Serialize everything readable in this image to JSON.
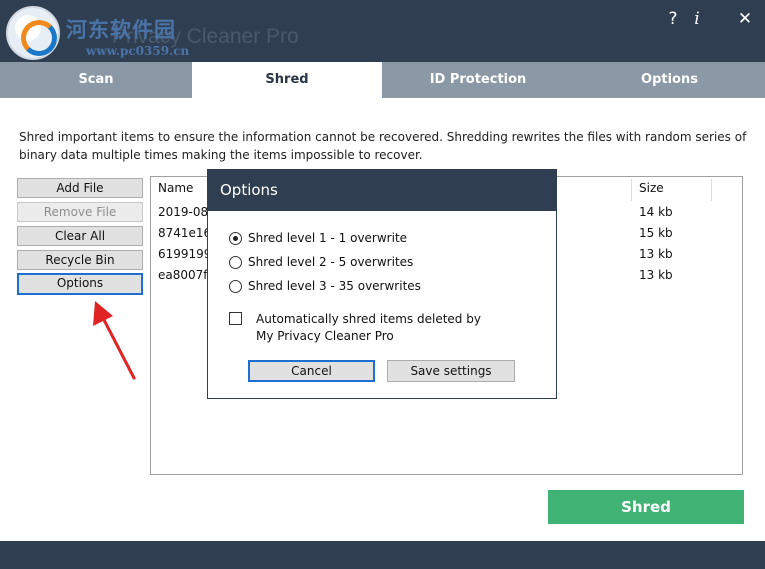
{
  "window": {
    "title": "Privacy Cleaner Pro",
    "watermark": "河东软件园",
    "watermark_url": "www.pc0359.cn",
    "help_label": "?",
    "info_label": "i",
    "close_label": "✕"
  },
  "tabs": [
    {
      "label": "Scan",
      "active": false
    },
    {
      "label": "Shred",
      "active": true
    },
    {
      "label": "ID Protection",
      "active": false
    },
    {
      "label": "Options",
      "active": false
    }
  ],
  "description": "Shred important items to ensure the information cannot be recovered. Shredding rewrites the files with random series of binary data multiple times making the items impossible to recover.",
  "side_buttons": [
    {
      "label": "Add File",
      "enabled": true
    },
    {
      "label": "Remove File",
      "enabled": false
    },
    {
      "label": "Clear All",
      "enabled": true
    },
    {
      "label": "Recycle Bin",
      "enabled": true
    },
    {
      "label": "Options",
      "enabled": true,
      "focused": true
    }
  ],
  "file_list": {
    "columns": [
      "Name",
      "Size"
    ],
    "rows": [
      {
        "name": "2019-08-",
        "size": "14 kb"
      },
      {
        "name": "8741e16",
        "size": "15 kb"
      },
      {
        "name": "6199199",
        "size": "13 kb"
      },
      {
        "name": "ea8007f2",
        "size": "13 kb"
      }
    ]
  },
  "shred_button": "Shred",
  "dialog": {
    "title": "Options",
    "levels": [
      {
        "label": "Shred level 1  - 1 overwrite",
        "checked": true
      },
      {
        "label": "Shred level 2  - 5 overwrites",
        "checked": false
      },
      {
        "label": "Shred level 3  - 35 overwrites",
        "checked": false
      }
    ],
    "auto_shred_label_1": "Automatically shred items deleted by",
    "auto_shred_label_2": "My Privacy Cleaner Pro",
    "auto_shred_checked": false,
    "cancel": "Cancel",
    "save": "Save settings"
  },
  "colors": {
    "titlebar": "#2f3e50",
    "tab_inactive": "#8b98a6",
    "accent_green": "#3fb274",
    "annotation_arrow": "#e02424"
  }
}
